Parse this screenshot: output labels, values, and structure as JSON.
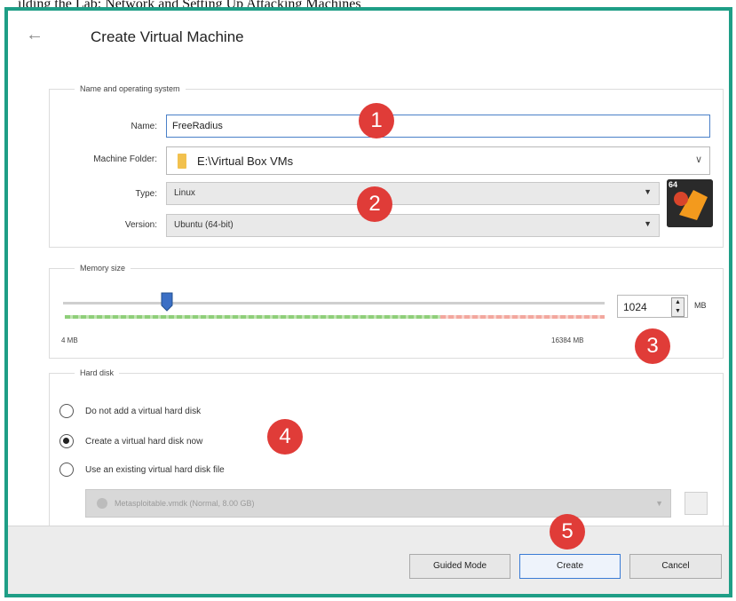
{
  "caption": "ilding the Lab: Network and Setting Up Attacking Machines",
  "dialog": {
    "title": "Create Virtual Machine"
  },
  "name_os": {
    "legend": "Name and operating system",
    "name_label": "Name:",
    "name_value": "FreeRadius",
    "folder_label": "Machine Folder:",
    "folder_value": "E:\\Virtual Box VMs",
    "type_label": "Type:",
    "type_value": "Linux",
    "version_label": "Version:",
    "version_value": "Ubuntu (64-bit)",
    "os_badge": "64"
  },
  "memory": {
    "legend": "Memory size",
    "value": "1024",
    "unit": "MB",
    "min_label": "4 MB",
    "max_label": "16384 MB",
    "min_mb": 4,
    "max_mb": 16384,
    "current_mb": 1024
  },
  "hard_disk": {
    "legend": "Hard disk",
    "options": [
      {
        "label": "Do not add a virtual hard disk",
        "selected": false
      },
      {
        "label": "Create a virtual hard disk now",
        "selected": true
      },
      {
        "label": "Use an existing virtual hard disk file",
        "selected": false
      }
    ],
    "existing_file": "Metasploitable.vmdk (Normal, 8.00 GB)"
  },
  "markers": [
    "1",
    "2",
    "3",
    "4",
    "5"
  ],
  "buttons": {
    "guided": "Guided Mode",
    "create": "Create",
    "cancel": "Cancel"
  }
}
